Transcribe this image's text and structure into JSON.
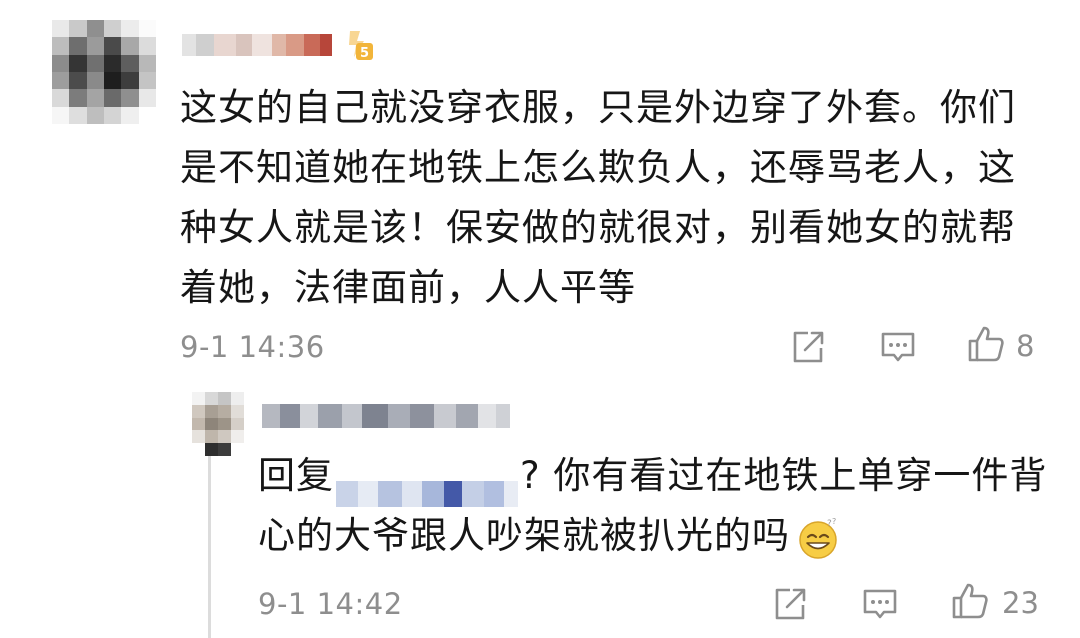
{
  "main_comment": {
    "text": "这女的自己就没穿衣服，只是外边穿了外套。你们是不知道她在地铁上怎么欺负人，还辱骂老人，这种女人就是该！保安做的就很对，别看她女的就帮着她，法律面前，人人平等",
    "timestamp": "9-1 14:36",
    "like_count": "8",
    "vip_level": "5"
  },
  "reply": {
    "prefix": "回复",
    "after_mention": "?  你有看过在地铁上单穿一件背心的大爷跟人吵架就被扒光的吗",
    "timestamp": "9-1 14:42",
    "like_count": "23"
  },
  "icons": {
    "share": "share-icon",
    "comment": "comment-icon",
    "like": "thumbs-up-icon",
    "emoji": "grinning-emoji-icon"
  },
  "colors": {
    "meta_text": "#8e8e8e",
    "body_text": "#161616",
    "thread_line": "#dcdcdc",
    "badge_gold": "#f2b53a"
  }
}
